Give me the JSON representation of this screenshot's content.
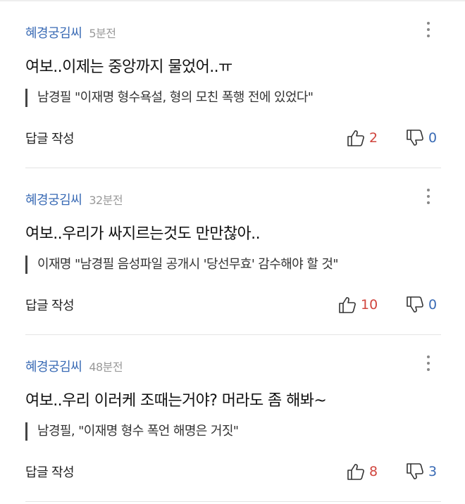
{
  "comments": [
    {
      "author": "혜경궁김씨",
      "time": "5분전",
      "text": "여보..이제는 중앙까지 물었어..ㅠ",
      "quote": "남경필 \"이재명 형수욕설, 형의 모친 폭행 전에 있었다\"",
      "reply_label": "답글 작성",
      "likes": "2",
      "dislikes": "0"
    },
    {
      "author": "혜경궁김씨",
      "time": "32분전",
      "text": "여보..우리가 싸지르는것도 만만찮아..",
      "quote": "이재명 \"남경필 음성파일 공개시 '당선무효' 감수해야 할 것\"",
      "reply_label": "답글 작성",
      "likes": "10",
      "dislikes": "0"
    },
    {
      "author": "혜경궁김씨",
      "time": "48분전",
      "text": "여보..우리 이러케 조때는거야? 머라도 좀 해봐~",
      "quote": "남경필, \"이재명 형수 폭언 해명은 거짓\"",
      "reply_label": "답글 작성",
      "likes": "8",
      "dislikes": "3"
    }
  ],
  "icons": {
    "more": "more-vertical-icon",
    "like": "thumbs-up-icon",
    "dislike": "thumbs-down-icon"
  },
  "colors": {
    "author": "#3a6bb5",
    "like_count": "#d0453e",
    "dislike_count": "#3a6bb5"
  }
}
